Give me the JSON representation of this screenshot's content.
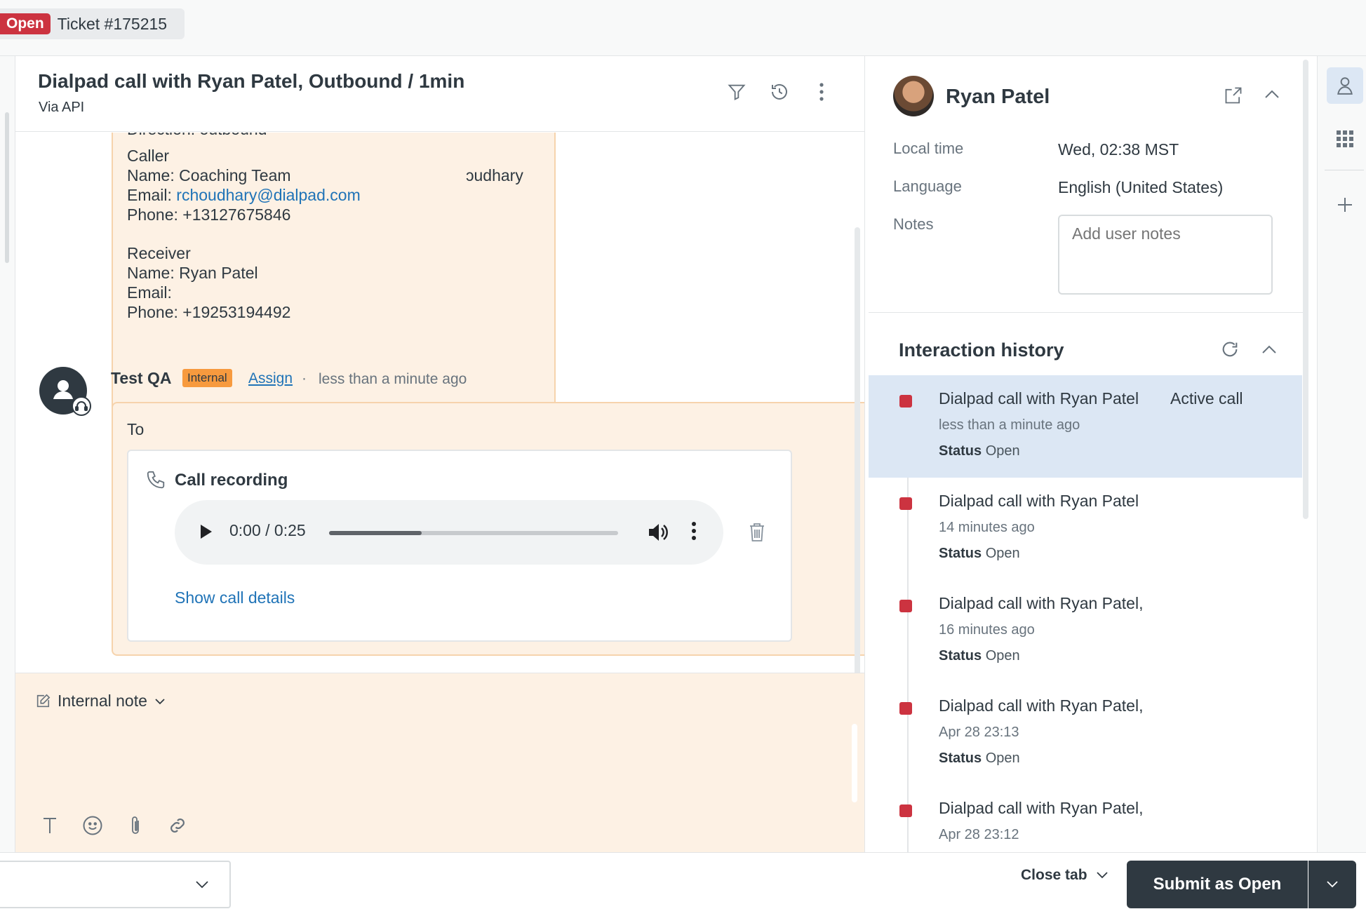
{
  "tab": {
    "status": "Open",
    "title": "Ticket #175215"
  },
  "conversation": {
    "title": "Dialpad call with Ryan Patel, Outbound / 1min",
    "via": "Via API",
    "call_card": {
      "direction_line": "Direction: outbound",
      "caller_heading": "Caller",
      "caller_name_label": "Name:",
      "caller_name": "Coaching Team",
      "caller_name_tail": "ɔudhary",
      "caller_email_label": "Email:",
      "caller_email": "rchoudhary@dialpad.com",
      "caller_phone": "Phone: +13127675846",
      "receiver_heading": "Receiver",
      "receiver_name": "Name: Ryan Patel",
      "receiver_email": "Email:",
      "receiver_phone": "Phone: +19253194492"
    },
    "message": {
      "author": "Test QA",
      "badge": "Internal",
      "assign": "Assign",
      "separator": "·",
      "time": "less than a minute ago",
      "to_label": "To",
      "recording_title": "Call recording",
      "player_time": "0:00 / 0:25",
      "progress": 0.32,
      "show_details": "Show call details"
    }
  },
  "composer": {
    "type_label": "Internal note"
  },
  "user": {
    "name": "Ryan Patel",
    "fields": {
      "local_time_label": "Local time",
      "local_time": "Wed, 02:38 MST",
      "language_label": "Language",
      "language": "English (United States)",
      "notes_label": "Notes",
      "notes_placeholder": "Add user notes"
    }
  },
  "interaction_history": {
    "title": "Interaction history",
    "items": [
      {
        "title": "Dialpad call with Ryan Patel",
        "badge": "Active call",
        "time": "less than a minute ago",
        "status_label": "Status",
        "status": "Open"
      },
      {
        "title": "Dialpad call with  Ryan Patel",
        "badge": "",
        "time": "14 minutes ago",
        "status_label": "Status",
        "status": "Open"
      },
      {
        "title": "Dialpad call with  Ryan Patel,",
        "badge": "",
        "time": "16 minutes ago",
        "status_label": "Status",
        "status": "Open"
      },
      {
        "title": "Dialpad call with Ryan Patel,",
        "badge": "",
        "time": "Apr 28 23:13",
        "status_label": "Status",
        "status": "Open"
      },
      {
        "title": "Dialpad call with Ryan Patel,",
        "badge": "",
        "time": "Apr 28 23:12",
        "status_label": "",
        "status": ""
      }
    ]
  },
  "footer": {
    "macro_value": "",
    "close_tab": "Close tab",
    "submit_label": "Submit as Open"
  },
  "colors": {
    "status_open": "#cc3340",
    "internal_badge": "#f79a3e",
    "note_bg": "#fdf1e4",
    "link": "#1f73b7",
    "primary_dark": "#2f3941",
    "active_row": "#dce7f4"
  },
  "icons": [
    "filter-icon",
    "history-icon",
    "more-vertical-icon",
    "phone-icon",
    "play-icon",
    "volume-icon",
    "trash-icon",
    "edit-note-icon",
    "chevron-down-icon",
    "text-format-icon",
    "emoji-icon",
    "attachment-icon",
    "link-icon",
    "external-link-icon",
    "chevron-up-icon",
    "refresh-icon",
    "user-icon",
    "apps-icon",
    "plus-icon"
  ]
}
